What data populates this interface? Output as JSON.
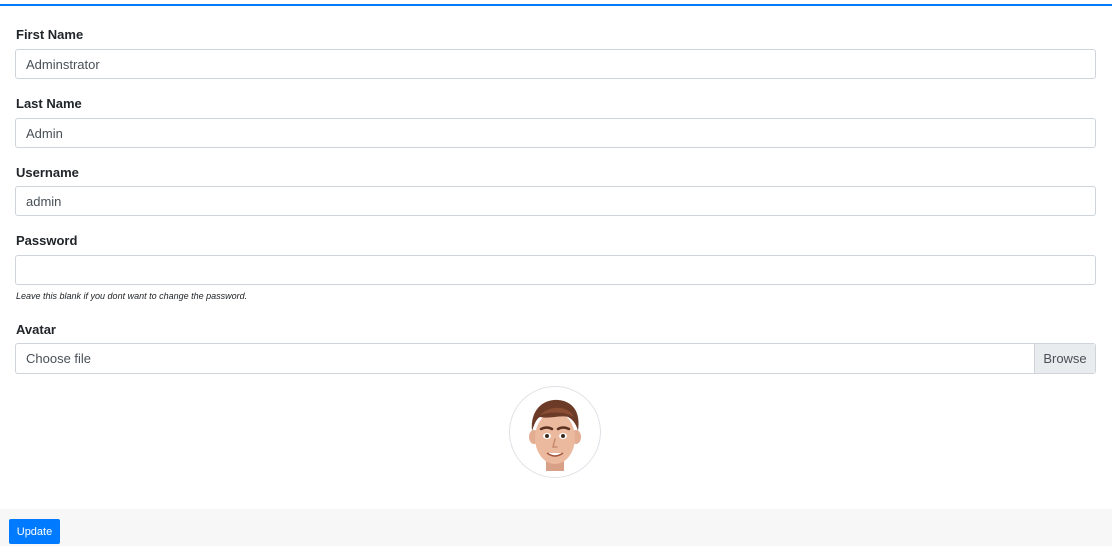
{
  "form": {
    "first_name": {
      "label": "First Name",
      "value": "Adminstrator"
    },
    "last_name": {
      "label": "Last Name",
      "value": "Admin"
    },
    "username": {
      "label": "Username",
      "value": "admin"
    },
    "password": {
      "label": "Password",
      "value": "",
      "help": "Leave this blank if you dont want to change the password."
    },
    "avatar": {
      "label": "Avatar",
      "file_placeholder": "Choose file",
      "browse_label": "Browse",
      "image_icon": "male-avatar-icon"
    }
  },
  "footer": {
    "update_label": "Update"
  },
  "colors": {
    "accent": "#007bff",
    "footer_bg": "#f7f7f7",
    "input_border": "#ced4da"
  }
}
